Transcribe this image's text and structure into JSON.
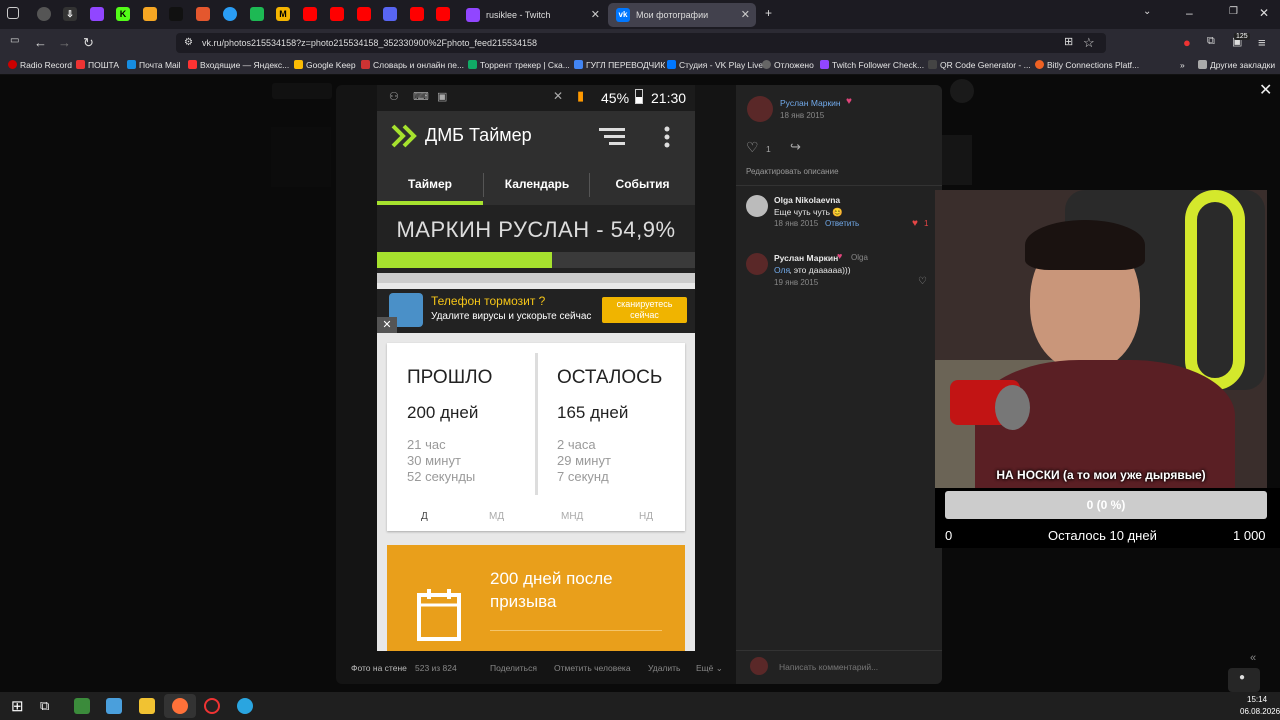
{
  "browser": {
    "tabs": [
      {
        "title": "rusiklee - Twitch",
        "active": false
      },
      {
        "title": "Мои фотографии",
        "active": true
      }
    ],
    "url": "vk.ru/photos215534158?z=photo215534158_352330900%2Fphoto_feed215534158",
    "bookmarks": [
      "Radio Record",
      "ПОШТА",
      "Почта Mail",
      "Входящие — Яндекс...",
      "Google Keep",
      "Словарь и онлайн пе...",
      "Торрент трекер | Ска...",
      "ГУГЛ ПЕРЕВОДЧИК",
      "Студия - VK Play Live",
      "Отложено",
      "Twitch Follower Check...",
      "QR Code Generator - ...",
      "Bitly Connections Platf...",
      "Другие закладки"
    ],
    "badge_count": "125"
  },
  "phone": {
    "status": {
      "battery": "45%",
      "time": "21:30"
    },
    "app_title": "ДМБ Таймер",
    "tabs": [
      "Таймер",
      "Календарь",
      "События"
    ],
    "progress_label": "МАРКИН РУСЛАН - 54,9%",
    "progress_fraction": 0.549,
    "ad": {
      "title": "Телефон тормозит ?",
      "text": "Удалите вирусы и  ускорьте сейчас",
      "button": "сканируетесь сейчас"
    },
    "passed": {
      "title": "ПРОШЛО",
      "days": "200 дней",
      "hours": "21 час",
      "minutes": "30 минут",
      "seconds": "52 секунды"
    },
    "left": {
      "title": "ОСТАЛОСЬ",
      "days": "165 дней",
      "hours": "2 часа",
      "minutes": "29 минут",
      "seconds": "7 секунд"
    },
    "units": [
      "Д",
      "МД",
      "МНД",
      "НД"
    ],
    "event": "200 дней после призыва"
  },
  "viewer": {
    "footer": {
      "album": "Фото на стене",
      "counter": "523 из 824",
      "share": "Поделиться",
      "tag": "Отметить человека",
      "delete": "Удалить",
      "more": "Ещё ⌄"
    },
    "author": {
      "name": "Руслан Маркин",
      "date": "18 янв 2015"
    },
    "likes": "1",
    "edit_description": "Редактировать описание",
    "comments": [
      {
        "name": "Olga Nikolaevna",
        "text": "Еще чуть чуть 😊",
        "date": "18 янв 2015",
        "reply": "Ответить",
        "likes": "1"
      },
      {
        "name": "Руслан Маркин",
        "reply_to": "Olga",
        "mention": "Оля",
        "text": ", это даааааа)))",
        "date": "19 янв 2015"
      }
    ],
    "comment_placeholder": "Написать комментарий..."
  },
  "stream": {
    "goal_title": "НА НОСКИ (а то мои уже дырявые)",
    "goal_progress": "0 (0 %)",
    "goal_min": "0",
    "goal_remaining": "Осталось 10 дней",
    "goal_max": "1 000"
  },
  "taskbar": {
    "time": "15:14",
    "date": "06.08.2026"
  },
  "colors": {
    "accent_green": "#a6e22e",
    "orange": "#e99f1b",
    "vk_blue": "#71aaeb"
  }
}
